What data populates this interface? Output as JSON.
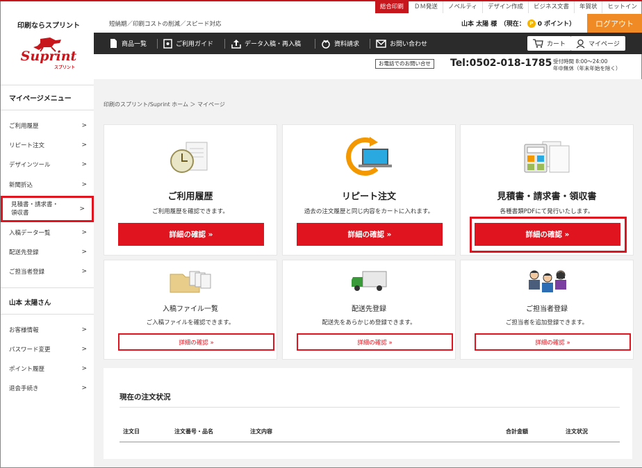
{
  "brand": {
    "catch": "印刷ならスプリント",
    "logo_text": "Suprint",
    "logo_sub": "スプリント"
  },
  "top_tabs": [
    {
      "label": "総合印刷",
      "active": true
    },
    {
      "label": "ＤＭ発送"
    },
    {
      "label": "ノベルティ"
    },
    {
      "label": "デザイン作成"
    },
    {
      "label": "ビジネス文書"
    },
    {
      "label": "年賀状"
    },
    {
      "label": "ヒットイン"
    }
  ],
  "header": {
    "tagline": "短納期／印刷コストの削減／スピード対応",
    "user_label": "山本 太陽 様　（現在：",
    "points": "0 ポイント）",
    "coin": "P",
    "logout": "ログアウト"
  },
  "nav": {
    "items": [
      "商品一覧",
      "ご利用ガイド",
      "データ入稿・再入稿",
      "資料請求",
      "お問い合わせ"
    ],
    "cart": "カート",
    "mypage": "マイページ"
  },
  "contact": {
    "ask": "お電話でのお問い合せ",
    "tel": "Tel:0502-018-1785",
    "hours_line1": "受付時間 8:00～24:00",
    "hours_line2": "年中無休（年末年始を除く）"
  },
  "sidebar": {
    "title": "マイページメニュー",
    "items": [
      "ご利用履歴",
      "リピート注文",
      "デザインツール",
      "新聞折込",
      "見積書・請求書・\n領収書",
      "入稿データ一覧",
      "配送先登録",
      "ご担当者登録"
    ],
    "user_title": "山本 太陽さん",
    "user_items": [
      "お客様情報",
      "パスワード変更",
      "ポイント履歴",
      "退会手続き"
    ],
    "chevron": ">"
  },
  "breadcrumb": "印刷のスプリント/Suprint ホーム ＞ マイページ",
  "cards_large": [
    {
      "title": "ご利用履歴",
      "desc": "ご利用履歴を確認できます。",
      "button": "詳細の確認 »",
      "icon": "clock-document-icon"
    },
    {
      "title": "リピート注文",
      "desc": "過去の注文履歴と同じ内容をカートに入れます。",
      "button": "詳細の確認 »",
      "icon": "laptop-refresh-icon"
    },
    {
      "title": "見積書・請求書・領収書",
      "desc": "各種書類PDFにて発行いたします。",
      "button": "詳細の確認 »",
      "icon": "calculator-documents-icon"
    }
  ],
  "cards_small": [
    {
      "title": "入稿ファイル一覧",
      "desc": "ご入稿ファイルを確認できます。",
      "button": "詳細の確認 »",
      "icon": "folder-files-icon"
    },
    {
      "title": "配送先登録",
      "desc": "配送先をあらかじめ登録できます。",
      "button": "詳細の確認 »",
      "icon": "truck-icon"
    },
    {
      "title": "ご担当者登録",
      "desc": "ご担当者を追加登録できます。",
      "button": "詳細の確認 »",
      "icon": "people-icon"
    }
  ],
  "order_status": {
    "title": "現在の注文状況",
    "columns": [
      "注文日",
      "注文番号・品名",
      "注文内容",
      "合計金額",
      "注文状況"
    ]
  },
  "colors": {
    "accent": "#e0141e",
    "dark_nav": "#2b2b2b",
    "logout": "#f08a24"
  }
}
